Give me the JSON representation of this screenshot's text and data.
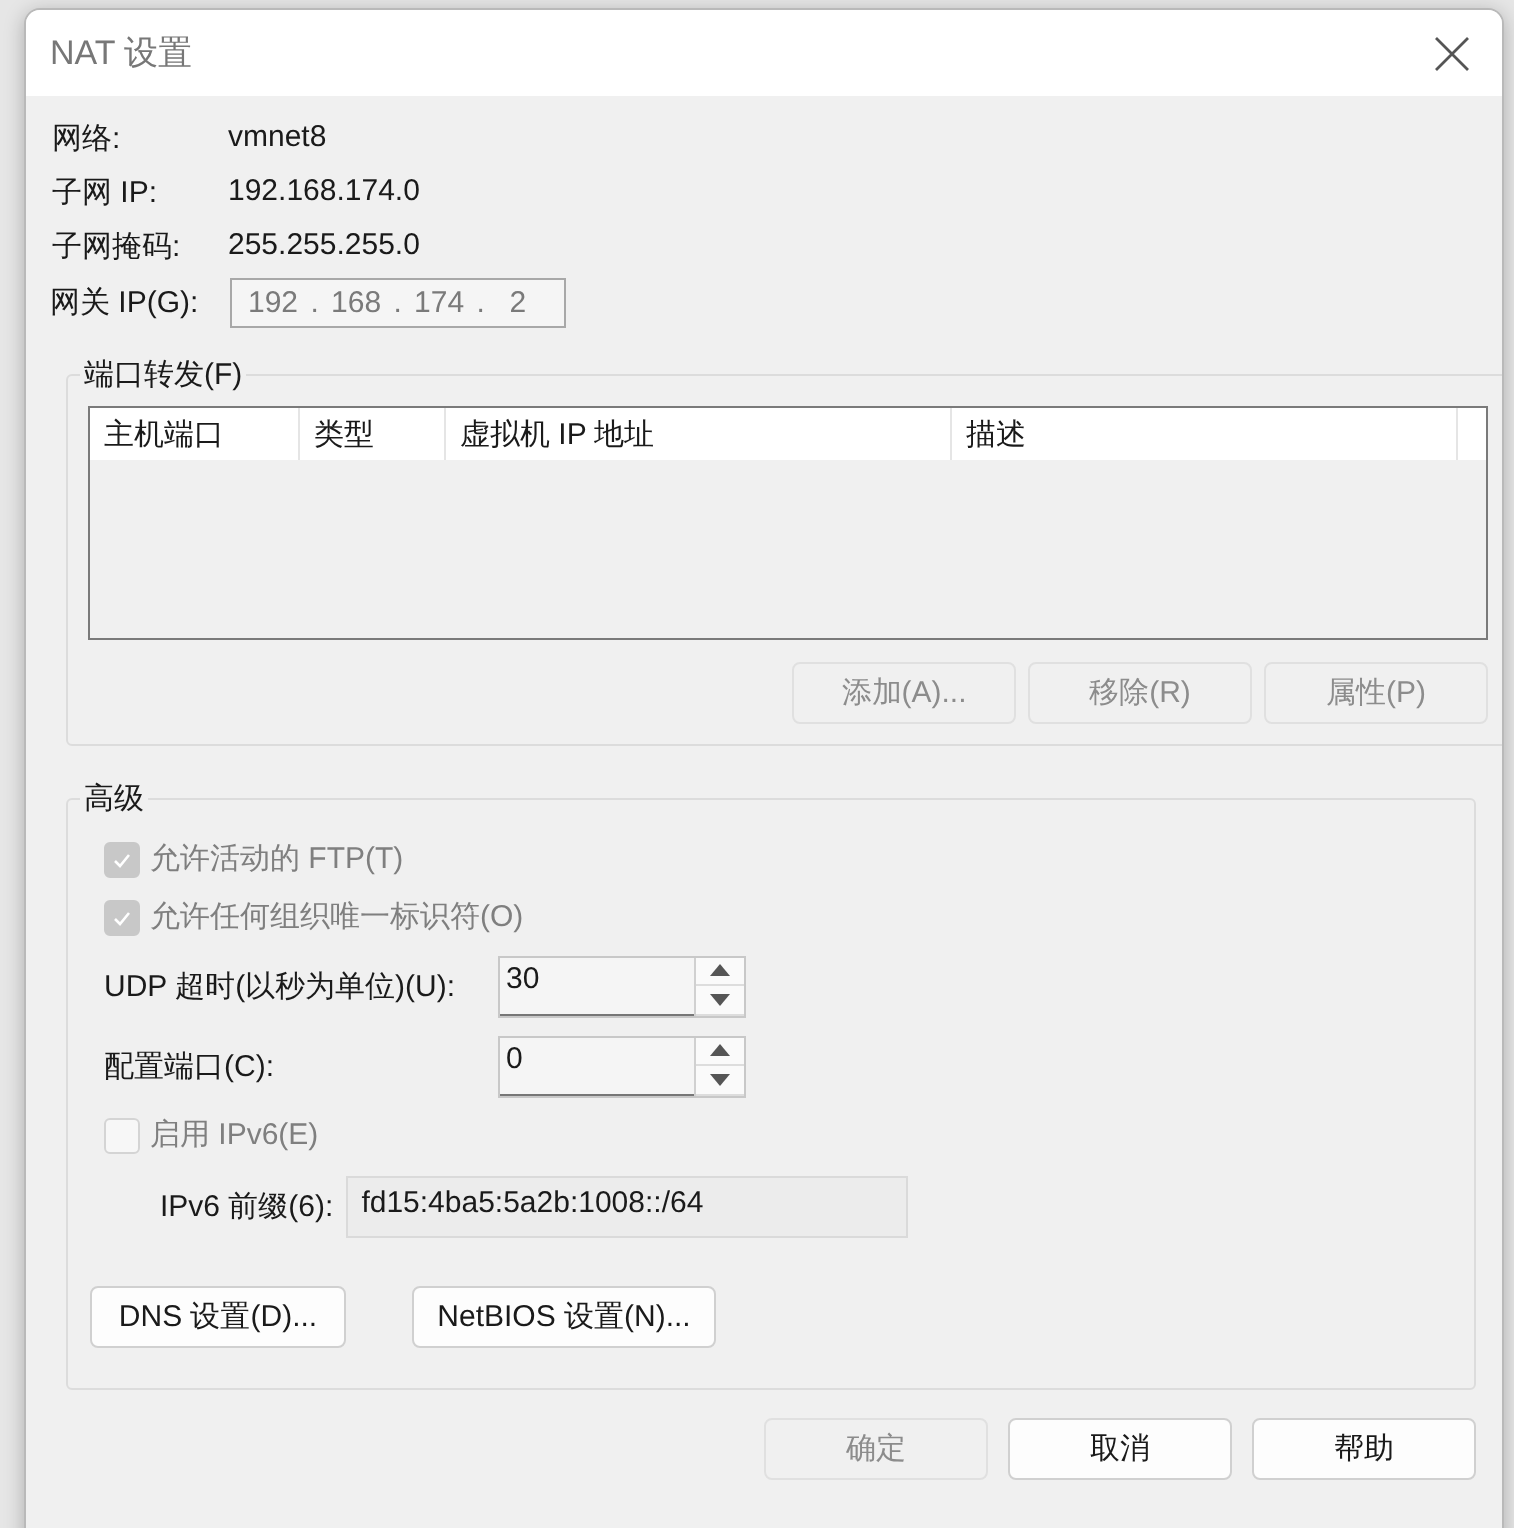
{
  "window": {
    "title": "NAT 设置"
  },
  "info": [
    {
      "label": "网络:",
      "value": "vmnet8"
    },
    {
      "label": "子网 IP:",
      "value": "192.168.174.0"
    },
    {
      "label": "子网掩码:",
      "value": "255.255.255.0"
    }
  ],
  "gateway": {
    "label": "网关 IP(G):",
    "value": "192 . 168 . 174 .  2",
    "disabled": true
  },
  "port_forwarding": {
    "title": "端口转发(F)",
    "columns": [
      "主机端口",
      "类型",
      "虚拟机 IP 地址",
      "描述"
    ],
    "buttons": [
      {
        "label": "添加(A)...",
        "disabled": true
      },
      {
        "label": "移除(R)",
        "disabled": true
      },
      {
        "label": "属性(P)",
        "disabled": true
      }
    ]
  },
  "advanced": {
    "title": "高级",
    "options": [
      {
        "kind": "checkbox",
        "label": "允许活动的 FTP(T)",
        "checked": true,
        "disabled": true
      },
      {
        "kind": "checkbox",
        "label": "允许任何组织唯一标识符(O)",
        "checked": true,
        "disabled": true
      },
      {
        "kind": "spinner",
        "label": "UDP 超时(以秒为单位)(U):",
        "value": "30"
      },
      {
        "kind": "spinner",
        "label": "配置端口(C):",
        "value": "0"
      },
      {
        "kind": "checkbox",
        "label": "启用 IPv6(E)",
        "checked": false,
        "disabled": true
      },
      {
        "kind": "field",
        "label": "IPv6 前缀(6):",
        "value": "fd15:4ba5:5a2b:1008::/64",
        "disabled": true
      }
    ],
    "buttons": [
      {
        "label": "DNS 设置(D)..."
      },
      {
        "label": "NetBIOS 设置(N)..."
      }
    ]
  },
  "footer_buttons": [
    {
      "label": "确定",
      "disabled": true
    },
    {
      "label": "取消",
      "disabled": false
    },
    {
      "label": "帮助",
      "disabled": false
    }
  ]
}
